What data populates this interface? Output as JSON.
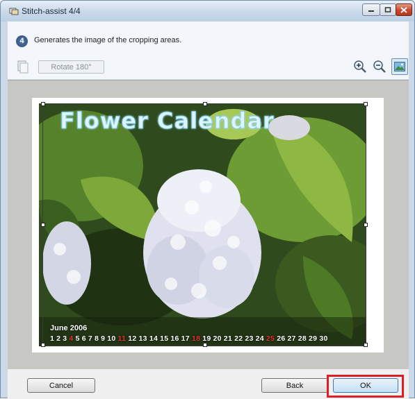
{
  "window": {
    "title": "Stitch-assist 4/4"
  },
  "step": {
    "number": "4",
    "text": "Generates the image of the cropping areas."
  },
  "toolbar": {
    "rotate_label": "Rotate 180°",
    "icons": [
      "rotate-page-icon",
      "zoom-in-icon",
      "zoom-out-icon",
      "fit-image-icon"
    ]
  },
  "preview": {
    "calendar_title": "Flower Calendar",
    "month": "June 2006",
    "days": [
      {
        "d": "1",
        "red": false
      },
      {
        "d": "2",
        "red": false
      },
      {
        "d": "3",
        "red": false
      },
      {
        "d": "4",
        "red": true
      },
      {
        "d": "5",
        "red": false
      },
      {
        "d": "6",
        "red": false
      },
      {
        "d": "7",
        "red": false
      },
      {
        "d": "8",
        "red": false
      },
      {
        "d": "9",
        "red": false
      },
      {
        "d": "10",
        "red": false
      },
      {
        "d": "11",
        "red": true
      },
      {
        "d": "12",
        "red": false
      },
      {
        "d": "13",
        "red": false
      },
      {
        "d": "14",
        "red": false
      },
      {
        "d": "15",
        "red": false
      },
      {
        "d": "16",
        "red": false
      },
      {
        "d": "17",
        "red": false
      },
      {
        "d": "18",
        "red": true
      },
      {
        "d": "19",
        "red": false
      },
      {
        "d": "20",
        "red": false
      },
      {
        "d": "21",
        "red": false
      },
      {
        "d": "22",
        "red": false
      },
      {
        "d": "23",
        "red": false
      },
      {
        "d": "24",
        "red": false
      },
      {
        "d": "25",
        "red": true
      },
      {
        "d": "26",
        "red": false
      },
      {
        "d": "27",
        "red": false
      },
      {
        "d": "28",
        "red": false
      },
      {
        "d": "29",
        "red": false
      },
      {
        "d": "30",
        "red": false
      }
    ]
  },
  "footer": {
    "cancel_label": "Cancel",
    "back_label": "Back",
    "ok_label": "OK"
  },
  "colors": {
    "highlight": "#e01d25",
    "accent": "#3a78b8"
  }
}
